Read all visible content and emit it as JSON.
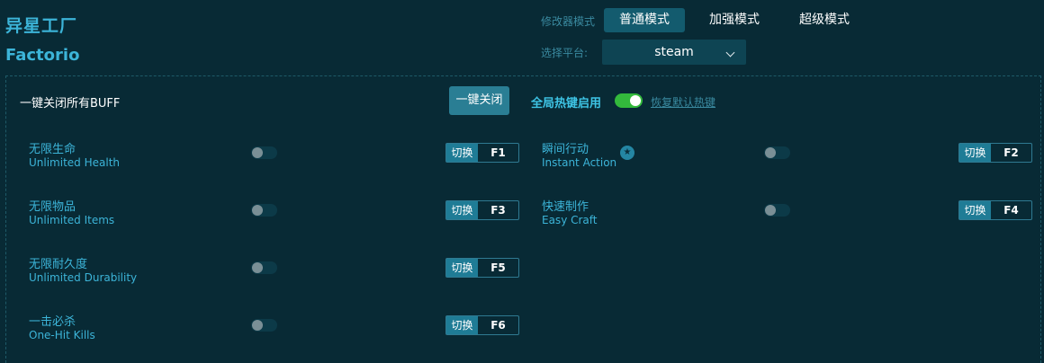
{
  "header": {
    "title_cn": "异星工厂",
    "title_en": "Factorio"
  },
  "modes": {
    "label": "修改器模式",
    "options": [
      "普通模式",
      "加强模式",
      "超级模式"
    ],
    "active": "普通模式"
  },
  "platform": {
    "label": "选择平台:",
    "value": "steam"
  },
  "toolbar": {
    "close_all_label": "一键关闭所有BUFF",
    "close_all_button": "一键关闭",
    "global_hotkey_label": "全局热键启用",
    "global_hotkey_enabled": true,
    "restore_label": "恢复默认热键"
  },
  "cheats": [
    {
      "name_cn": "无限生命",
      "name_en": "Unlimited Health",
      "enabled": false,
      "switch_label": "切换",
      "key": "F1"
    },
    {
      "name_cn": "瞬间行动",
      "name_en": "Instant Action",
      "enabled": false,
      "switch_label": "切换",
      "key": "F2",
      "starred": true
    },
    {
      "name_cn": "无限物品",
      "name_en": "Unlimited Items",
      "enabled": false,
      "switch_label": "切换",
      "key": "F3"
    },
    {
      "name_cn": "快速制作",
      "name_en": "Easy Craft",
      "enabled": false,
      "switch_label": "切换",
      "key": "F4"
    },
    {
      "name_cn": "无限耐久度",
      "name_en": "Unlimited Durability",
      "enabled": false,
      "switch_label": "切换",
      "key": "F5"
    },
    {
      "name_cn": "一击必杀",
      "name_en": "One-Hit Kills",
      "enabled": false,
      "switch_label": "切换",
      "key": "F6"
    }
  ],
  "colors": {
    "background": "#082a35",
    "accent": "#3cb4d8",
    "toggle_on": "#33b93c"
  }
}
